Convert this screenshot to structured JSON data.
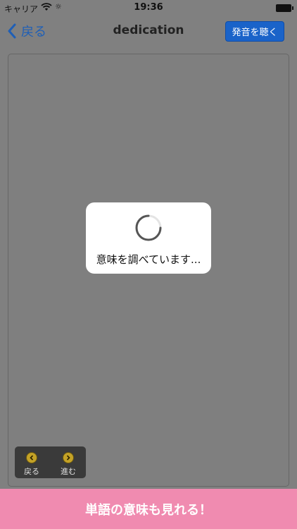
{
  "status_bar": {
    "carrier": "キャリア",
    "activity_symbol": "☼",
    "time": "19:36"
  },
  "nav": {
    "back_label": "戻る",
    "title": "dedication",
    "listen_label": "発音を聴く"
  },
  "loading": {
    "message": "意味を調べています..."
  },
  "toolbar": {
    "back_label": "戻る",
    "forward_label": "進む"
  },
  "banner": {
    "text": "単語の意味も見れる！"
  },
  "colors": {
    "accent": "#1a63c9",
    "banner": "#f08bb0",
    "overlay": "#808080"
  }
}
